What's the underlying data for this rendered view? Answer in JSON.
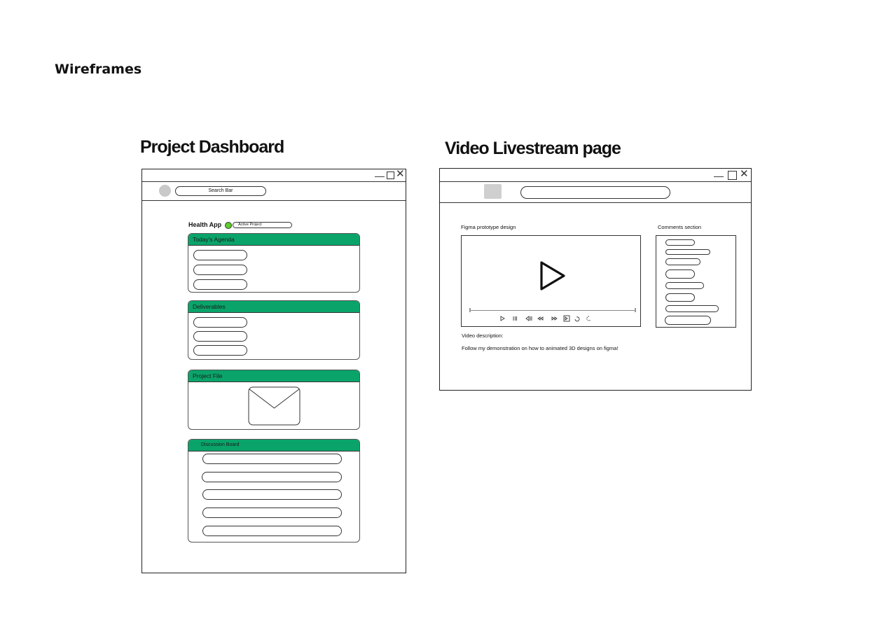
{
  "page": {
    "heading": "Wireframes"
  },
  "dashboard": {
    "title": "Project Dashboard",
    "search_label": "Search Bar",
    "project_name": "Health App",
    "status_badge": "Active Project",
    "status_color": "#5ccf2b",
    "accent_color": "#0aa46b",
    "cards": {
      "agenda": {
        "title": "Today's Agenda",
        "item_count": 3
      },
      "deliverables": {
        "title": "Deliverables",
        "item_count": 3
      },
      "project_file": {
        "title": "Project File",
        "icon": "envelope-icon"
      },
      "discussion": {
        "title": "Discussion Board",
        "item_count": 5
      }
    }
  },
  "livestream": {
    "title": "Video Livestream page",
    "video_label": "Figma prototype design",
    "comments_label": "Comments section",
    "description_label": "Video description:",
    "description_text": "Follow my demonstration on how to animated 3D designs on figma!",
    "player_icons": [
      "play-icon",
      "pause-icon",
      "skip-back-icon",
      "rewind-icon",
      "fast-forward-icon",
      "skip-forward-icon",
      "replay-icon",
      "loading-icon"
    ]
  }
}
